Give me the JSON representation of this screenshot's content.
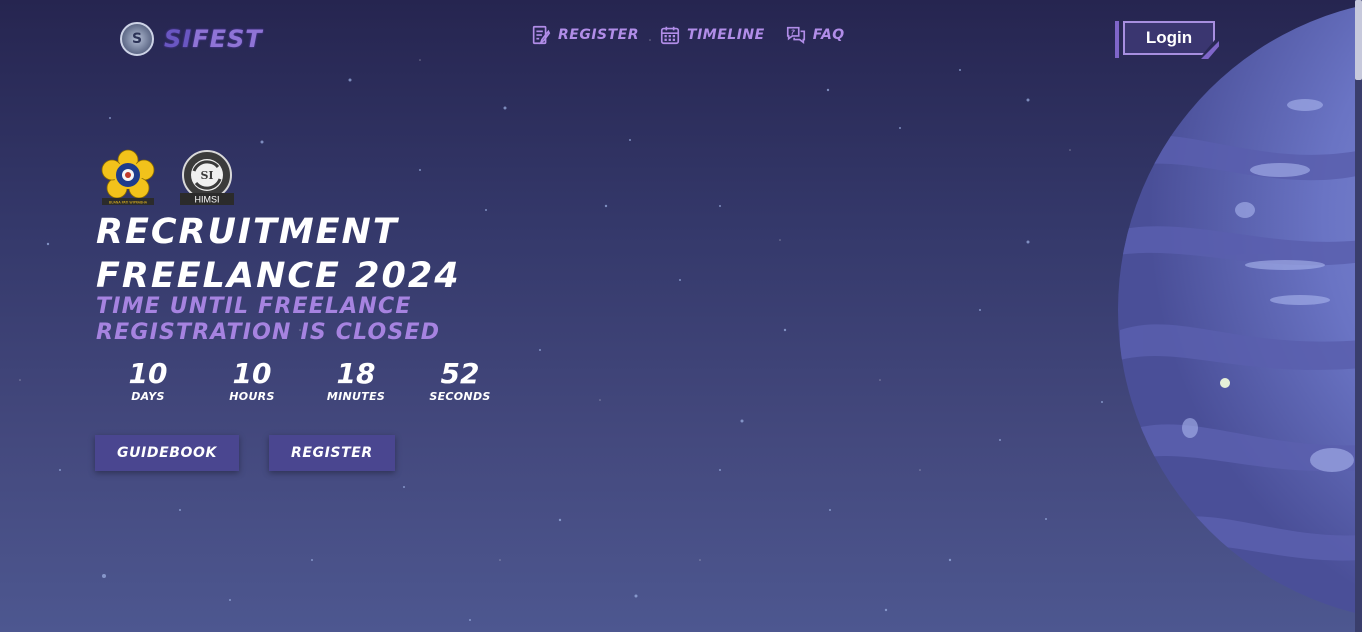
{
  "header": {
    "brand": {
      "prefix": "SI",
      "suffix": "FEST",
      "logo_letter": "S",
      "logo_icon": "sifest-logo-icon"
    },
    "nav": [
      {
        "label": "REGISTER",
        "icon": "register-icon"
      },
      {
        "label": "TIMELINE",
        "icon": "calendar-icon"
      },
      {
        "label": "FAQ",
        "icon": "faq-icon"
      }
    ],
    "login_label": "Login"
  },
  "hero": {
    "logos": [
      {
        "name": "unsri-logo",
        "caption": "BUANA PATI WIPRABHA"
      },
      {
        "name": "himsi-logo",
        "text": "SI",
        "caption": "HIMSI"
      }
    ],
    "title_line1": "RECRUITMENT",
    "title_line2": "FREELANCE 2024",
    "subtitle_line1": "TIME UNTIL FREELANCE",
    "subtitle_line2": "REGISTRATION IS CLOSED",
    "countdown": [
      {
        "value": "10",
        "label": "DAYS"
      },
      {
        "value": "10",
        "label": "HOURS"
      },
      {
        "value": "18",
        "label": "MINUTES"
      },
      {
        "value": "52",
        "label": "SECONDS"
      }
    ],
    "buttons": {
      "guidebook": "GUIDEBOOK",
      "register": "REGISTER"
    }
  },
  "colors": {
    "background_top": "#262550",
    "background_bottom": "#4d5790",
    "accent_purple": "#a683e0",
    "button_bg": "#4a4690",
    "planet": "#6a74c4"
  }
}
